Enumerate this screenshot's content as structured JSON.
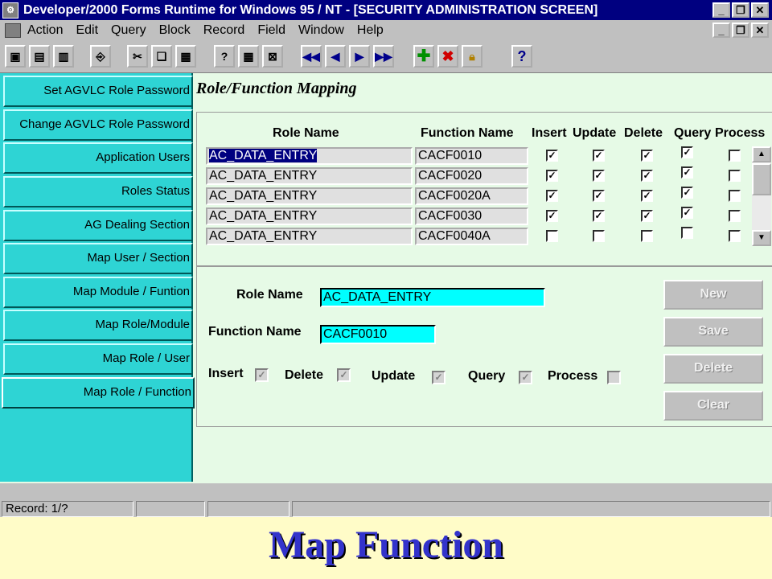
{
  "window": {
    "title": "Developer/2000 Forms Runtime for Windows 95 / NT - [SECURITY ADMINISTRATION SCREEN]"
  },
  "menu": [
    "Action",
    "Edit",
    "Query",
    "Block",
    "Record",
    "Field",
    "Window",
    "Help"
  ],
  "toolbar": {
    "buttons": [
      "save-icon",
      "print-icon",
      "print-setup-icon",
      "exit-icon",
      "cut-icon",
      "copy-icon",
      "paste-icon",
      "enter-query-icon",
      "execute-query-icon",
      "cancel-query-icon",
      "first-record-icon",
      "previous-record-icon",
      "next-record-icon",
      "last-record-icon",
      "insert-record-icon",
      "delete-record-icon",
      "lock-record-icon",
      "help-icon"
    ]
  },
  "sidebar": {
    "items": [
      "Set AGVLC Role Password",
      "Change AGVLC Role Password",
      "Application Users",
      "Roles Status",
      "AG Dealing Section",
      "Map User / Section",
      "Map Module / Funtion",
      "Map Role/Module",
      "Map Role / User",
      "Map Role / Function"
    ],
    "active": "Map Role / Function"
  },
  "section_title": "Role/Function Mapping",
  "grid": {
    "headers": {
      "role": "Role Name",
      "function": "Function Name",
      "insert": "Insert",
      "update": "Update",
      "delete": "Delete",
      "query": "Query",
      "process": "Process"
    },
    "rows": [
      {
        "role": "AC_DATA_ENTRY",
        "function": "CACF0010",
        "insert": true,
        "update": true,
        "delete": true,
        "query": true,
        "process": false
      },
      {
        "role": "AC_DATA_ENTRY",
        "function": "CACF0020",
        "insert": true,
        "update": true,
        "delete": true,
        "query": true,
        "process": false
      },
      {
        "role": "AC_DATA_ENTRY",
        "function": "CACF0020A",
        "insert": true,
        "update": true,
        "delete": true,
        "query": true,
        "process": false
      },
      {
        "role": "AC_DATA_ENTRY",
        "function": "CACF0030",
        "insert": true,
        "update": true,
        "delete": true,
        "query": true,
        "process": false
      },
      {
        "role": "AC_DATA_ENTRY",
        "function": "CACF0040A",
        "insert": false,
        "update": false,
        "delete": false,
        "query": false,
        "process": false
      }
    ]
  },
  "detail": {
    "role_label": "Role Name",
    "role_value": "AC_DATA_ENTRY",
    "function_label": "Function Name",
    "function_value": "CACF0010",
    "insert_label": "Insert",
    "delete_label": "Delete",
    "update_label": "Update",
    "query_label": "Query",
    "process_label": "Process",
    "insert": true,
    "delete": true,
    "update": true,
    "query": true,
    "process": false
  },
  "actions": {
    "new": "New",
    "save": "Save",
    "delete": "Delete",
    "clear": "Clear"
  },
  "status": {
    "record": "Record: 1/?"
  },
  "caption": "Map Function",
  "colors": {
    "title_bar": "#000080",
    "sidebar": "#2ed4d4",
    "workspace": "#e6fae6",
    "input": "#00ffff",
    "caption": "#3333cc"
  }
}
